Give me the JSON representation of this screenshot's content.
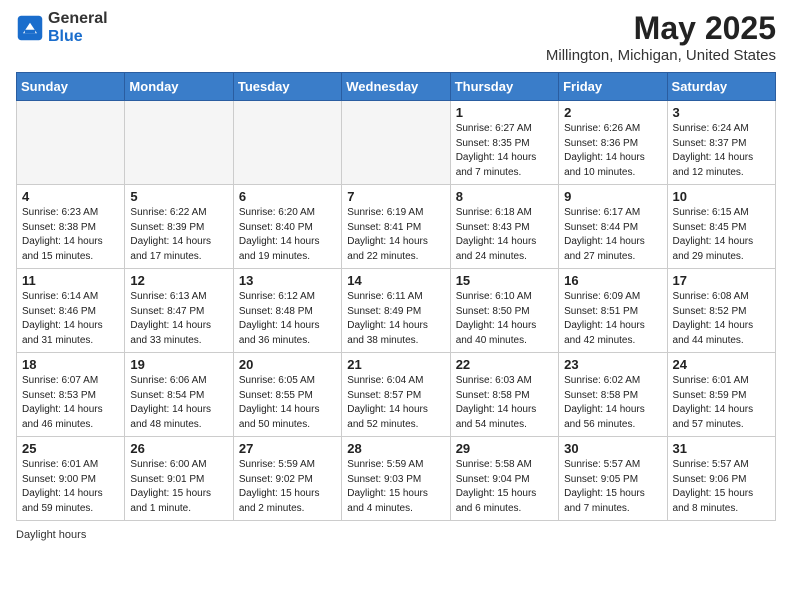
{
  "logo": {
    "general": "General",
    "blue": "Blue"
  },
  "header": {
    "title": "May 2025",
    "subtitle": "Millington, Michigan, United States"
  },
  "days_of_week": [
    "Sunday",
    "Monday",
    "Tuesday",
    "Wednesday",
    "Thursday",
    "Friday",
    "Saturday"
  ],
  "weeks": [
    [
      {
        "day": "",
        "info": ""
      },
      {
        "day": "",
        "info": ""
      },
      {
        "day": "",
        "info": ""
      },
      {
        "day": "",
        "info": ""
      },
      {
        "day": "1",
        "info": "Sunrise: 6:27 AM\nSunset: 8:35 PM\nDaylight: 14 hours\nand 7 minutes."
      },
      {
        "day": "2",
        "info": "Sunrise: 6:26 AM\nSunset: 8:36 PM\nDaylight: 14 hours\nand 10 minutes."
      },
      {
        "day": "3",
        "info": "Sunrise: 6:24 AM\nSunset: 8:37 PM\nDaylight: 14 hours\nand 12 minutes."
      }
    ],
    [
      {
        "day": "4",
        "info": "Sunrise: 6:23 AM\nSunset: 8:38 PM\nDaylight: 14 hours\nand 15 minutes."
      },
      {
        "day": "5",
        "info": "Sunrise: 6:22 AM\nSunset: 8:39 PM\nDaylight: 14 hours\nand 17 minutes."
      },
      {
        "day": "6",
        "info": "Sunrise: 6:20 AM\nSunset: 8:40 PM\nDaylight: 14 hours\nand 19 minutes."
      },
      {
        "day": "7",
        "info": "Sunrise: 6:19 AM\nSunset: 8:41 PM\nDaylight: 14 hours\nand 22 minutes."
      },
      {
        "day": "8",
        "info": "Sunrise: 6:18 AM\nSunset: 8:43 PM\nDaylight: 14 hours\nand 24 minutes."
      },
      {
        "day": "9",
        "info": "Sunrise: 6:17 AM\nSunset: 8:44 PM\nDaylight: 14 hours\nand 27 minutes."
      },
      {
        "day": "10",
        "info": "Sunrise: 6:15 AM\nSunset: 8:45 PM\nDaylight: 14 hours\nand 29 minutes."
      }
    ],
    [
      {
        "day": "11",
        "info": "Sunrise: 6:14 AM\nSunset: 8:46 PM\nDaylight: 14 hours\nand 31 minutes."
      },
      {
        "day": "12",
        "info": "Sunrise: 6:13 AM\nSunset: 8:47 PM\nDaylight: 14 hours\nand 33 minutes."
      },
      {
        "day": "13",
        "info": "Sunrise: 6:12 AM\nSunset: 8:48 PM\nDaylight: 14 hours\nand 36 minutes."
      },
      {
        "day": "14",
        "info": "Sunrise: 6:11 AM\nSunset: 8:49 PM\nDaylight: 14 hours\nand 38 minutes."
      },
      {
        "day": "15",
        "info": "Sunrise: 6:10 AM\nSunset: 8:50 PM\nDaylight: 14 hours\nand 40 minutes."
      },
      {
        "day": "16",
        "info": "Sunrise: 6:09 AM\nSunset: 8:51 PM\nDaylight: 14 hours\nand 42 minutes."
      },
      {
        "day": "17",
        "info": "Sunrise: 6:08 AM\nSunset: 8:52 PM\nDaylight: 14 hours\nand 44 minutes."
      }
    ],
    [
      {
        "day": "18",
        "info": "Sunrise: 6:07 AM\nSunset: 8:53 PM\nDaylight: 14 hours\nand 46 minutes."
      },
      {
        "day": "19",
        "info": "Sunrise: 6:06 AM\nSunset: 8:54 PM\nDaylight: 14 hours\nand 48 minutes."
      },
      {
        "day": "20",
        "info": "Sunrise: 6:05 AM\nSunset: 8:55 PM\nDaylight: 14 hours\nand 50 minutes."
      },
      {
        "day": "21",
        "info": "Sunrise: 6:04 AM\nSunset: 8:57 PM\nDaylight: 14 hours\nand 52 minutes."
      },
      {
        "day": "22",
        "info": "Sunrise: 6:03 AM\nSunset: 8:58 PM\nDaylight: 14 hours\nand 54 minutes."
      },
      {
        "day": "23",
        "info": "Sunrise: 6:02 AM\nSunset: 8:58 PM\nDaylight: 14 hours\nand 56 minutes."
      },
      {
        "day": "24",
        "info": "Sunrise: 6:01 AM\nSunset: 8:59 PM\nDaylight: 14 hours\nand 57 minutes."
      }
    ],
    [
      {
        "day": "25",
        "info": "Sunrise: 6:01 AM\nSunset: 9:00 PM\nDaylight: 14 hours\nand 59 minutes."
      },
      {
        "day": "26",
        "info": "Sunrise: 6:00 AM\nSunset: 9:01 PM\nDaylight: 15 hours\nand 1 minute."
      },
      {
        "day": "27",
        "info": "Sunrise: 5:59 AM\nSunset: 9:02 PM\nDaylight: 15 hours\nand 2 minutes."
      },
      {
        "day": "28",
        "info": "Sunrise: 5:59 AM\nSunset: 9:03 PM\nDaylight: 15 hours\nand 4 minutes."
      },
      {
        "day": "29",
        "info": "Sunrise: 5:58 AM\nSunset: 9:04 PM\nDaylight: 15 hours\nand 6 minutes."
      },
      {
        "day": "30",
        "info": "Sunrise: 5:57 AM\nSunset: 9:05 PM\nDaylight: 15 hours\nand 7 minutes."
      },
      {
        "day": "31",
        "info": "Sunrise: 5:57 AM\nSunset: 9:06 PM\nDaylight: 15 hours\nand 8 minutes."
      }
    ]
  ],
  "footer": {
    "daylight_label": "Daylight hours"
  }
}
